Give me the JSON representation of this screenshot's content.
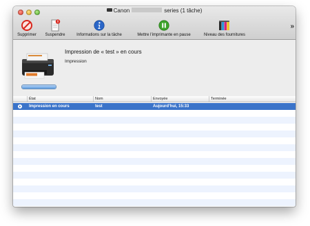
{
  "window": {
    "title_prefix": "Canon",
    "title_suffix": "series (1 tâche)"
  },
  "toolbar": {
    "delete_label": "Supprimer",
    "suspend_label": "Suspendre",
    "info_label": "Informations sur la tâche",
    "pause_label": "Mettre l’imprimante en pause",
    "supplies_label": "Niveau des fournitures",
    "overflow_label": "»"
  },
  "job": {
    "title": "Impression de « test » en cours",
    "status": "Impression",
    "progress": 1.0
  },
  "table": {
    "columns": [
      "État",
      "Nom",
      "Envoyée",
      "Terminée"
    ],
    "rows": [
      {
        "state": "Impression en cours",
        "name": "test",
        "sent": "Aujourd’hui, 15:33",
        "finished": ""
      }
    ]
  },
  "colors": {
    "selection": "#3a73c9",
    "stripe": "#edf3fe",
    "delete_icon": "#d8261c",
    "info_icon": "#2a66c8",
    "pause_icon": "#3da32a"
  },
  "icons": {
    "delete": "delete-circle-icon",
    "suspend": "suspend-document-icon",
    "info": "info-icon",
    "pause": "pause-icon",
    "supplies": "ink-cartridges-icon",
    "printer": "printer-icon"
  }
}
